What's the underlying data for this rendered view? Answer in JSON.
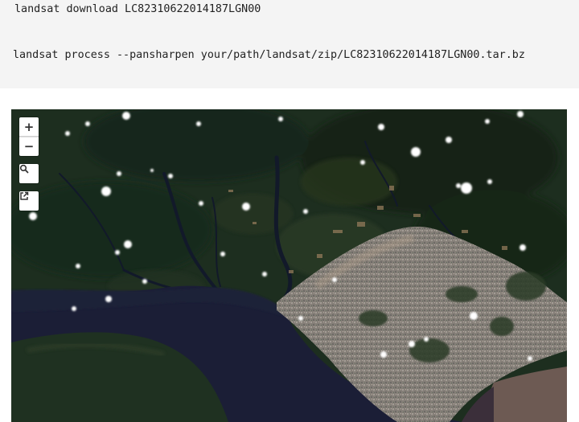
{
  "code": {
    "download_cmd": "landsat download LC82310622014187LGN00",
    "process_cmd": "landsat process --pansharpen your/path/landsat/zip/LC82310622014187LGN00.tar.bz"
  },
  "map": {
    "controls": {
      "zoom_in": "+",
      "zoom_out": "−"
    },
    "colors": {
      "forest": "#1d2e1f",
      "forest_dark": "#142316",
      "river": "#1a1d35",
      "urban": "#8f8b86",
      "sediment_water": "#6e5a52",
      "cloud": "#ffffff"
    }
  }
}
